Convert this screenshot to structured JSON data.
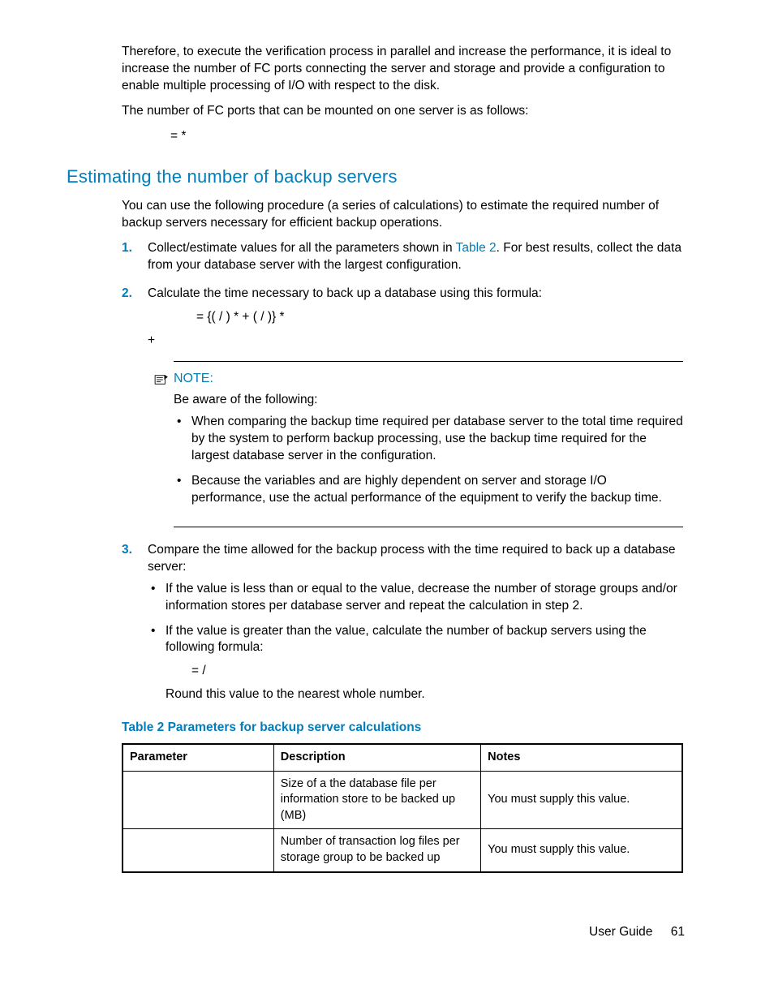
{
  "intro_p1": "Therefore, to execute the verification process in parallel and increase the performance, it is ideal to increase the number of FC ports connecting the server and storage and provide a configuration to enable multiple processing of I/O with respect to the disk.",
  "intro_p2": "The number of FC ports that can be mounted on one server is as follows:",
  "formula1": "=                                                                    *",
  "heading": "Estimating the number of backup servers",
  "sect_p1": "You can use the following procedure (a series of calculations) to estimate the required number of backup servers necessary for efficient backup operations.",
  "steps": {
    "s1_a": "Collect/estimate values for all the parameters shown in ",
    "s1_link": "Table 2",
    "s1_b": ". For best results, collect the data from your database server with the largest configuration.",
    "s2": "Calculate the time necessary to back up a database using this formula:",
    "s2_formula_a": "= {(      /                    ) *              + (                /                    )} *",
    "s2_formula_b": "+",
    "s3": "Compare the time allowed for the backup process with the time required to back up a database server:"
  },
  "note": {
    "title": "NOTE:",
    "intro": "Be aware of the following:",
    "b1": "When comparing the backup time required per database server to the total time required by the system to perform backup processing, use the backup time required for the largest database server in the configuration.",
    "b2": "Because the variables                         and                         are highly dependent on server and storage I/O performance, use the actual performance of the equipment to verify the backup time."
  },
  "s3_b1": "If the                                        value is less than or equal to the                                value, decrease the number of storage groups and/or information stores per database server and repeat the calculation in step 2.",
  "s3_b2a": "If the                                        value is greater than the                                value, calculate the number of backup servers using the following formula:",
  "s3_b2_formula": "=                    /",
  "s3_b2b": "Round this value to the nearest whole number.",
  "table": {
    "caption": "Table 2 Parameters for backup server calculations",
    "h1": "Parameter",
    "h2": "Description",
    "h3": "Notes",
    "r1c2": "Size of a the database file per information store to be backed up (MB)",
    "r1c3": "You must supply this value.",
    "r2c2": "Number of transaction log files per storage group to be backed up",
    "r2c3": "You must supply this value."
  },
  "footer": {
    "label": "User Guide",
    "page": "61"
  }
}
